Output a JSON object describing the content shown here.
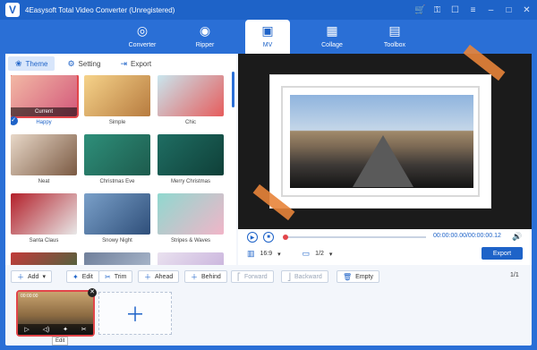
{
  "app": {
    "title": "4Easysoft Total Video Converter (Unregistered)",
    "logo": "V"
  },
  "window_controls": [
    "cart-icon",
    "key-icon",
    "feedback-icon",
    "menu-icon",
    "minimize-icon",
    "maximize-icon",
    "close-icon"
  ],
  "nav": {
    "items": [
      {
        "label": "Converter",
        "icon": "converter-icon",
        "glyph": "◎"
      },
      {
        "label": "Ripper",
        "icon": "ripper-icon",
        "glyph": "◉"
      },
      {
        "label": "MV",
        "icon": "mv-icon",
        "glyph": "▣",
        "active": true
      },
      {
        "label": "Collage",
        "icon": "collage-icon",
        "glyph": "▦"
      },
      {
        "label": "Toolbox",
        "icon": "toolbox-icon",
        "glyph": "▤"
      }
    ]
  },
  "tabs": [
    {
      "label": "Theme",
      "glyph": "❀",
      "active": true
    },
    {
      "label": "Setting",
      "glyph": "⚙"
    },
    {
      "label": "Export",
      "glyph": "⇥"
    }
  ],
  "themes": [
    {
      "label": "Happy",
      "current_label": "Current",
      "selected": true,
      "color1": "#f2b9a5",
      "color2": "#d3577a"
    },
    {
      "label": "Simple",
      "color1": "#f6d38a",
      "color2": "#b77b3f"
    },
    {
      "label": "Chic",
      "color1": "#c9e6ee",
      "color2": "#e65c5c"
    },
    {
      "label": "Neat",
      "color1": "#e8d8c8",
      "color2": "#7b5a43"
    },
    {
      "label": "Christmas Eve",
      "color1": "#2e8f7a",
      "color2": "#1d5b4d"
    },
    {
      "label": "Merry Christmas",
      "color1": "#1f6e63",
      "color2": "#0f3f38"
    },
    {
      "label": "Santa Claus",
      "color1": "#b3202a",
      "color2": "#e8e8e8"
    },
    {
      "label": "Snowy Night",
      "color1": "#7aa0c9",
      "color2": "#2f4f7a"
    },
    {
      "label": "Stripes & Waves",
      "color1": "#8fd8cf",
      "color2": "#f1b5c8"
    },
    {
      "label": "",
      "color1": "#c23a3a",
      "color2": "#2f6f3f"
    },
    {
      "label": "",
      "color1": "#6f7f9a",
      "color2": "#b8c5d8"
    },
    {
      "label": "",
      "color1": "#e9e1ef",
      "color2": "#c2a8d8"
    }
  ],
  "player": {
    "timecode": "00:00:00.00/00:00:00.12",
    "aspect_ratio": "16:9",
    "page": "1/2",
    "export_label": "Export",
    "progress": 0
  },
  "toolbar": {
    "add": "Add",
    "edit": "Edit",
    "trim": "Trim",
    "ahead": "Ahead",
    "behind": "Behind",
    "forward": "Forward",
    "backward": "Backward",
    "empty": "Empty",
    "pager": "1/1"
  },
  "timeline": {
    "clip_time": "00:00:00",
    "tooltip": "Edit"
  },
  "colors": {
    "accent": "#1e63c8",
    "selected": "#e2454a",
    "tape": "#e8843a"
  }
}
